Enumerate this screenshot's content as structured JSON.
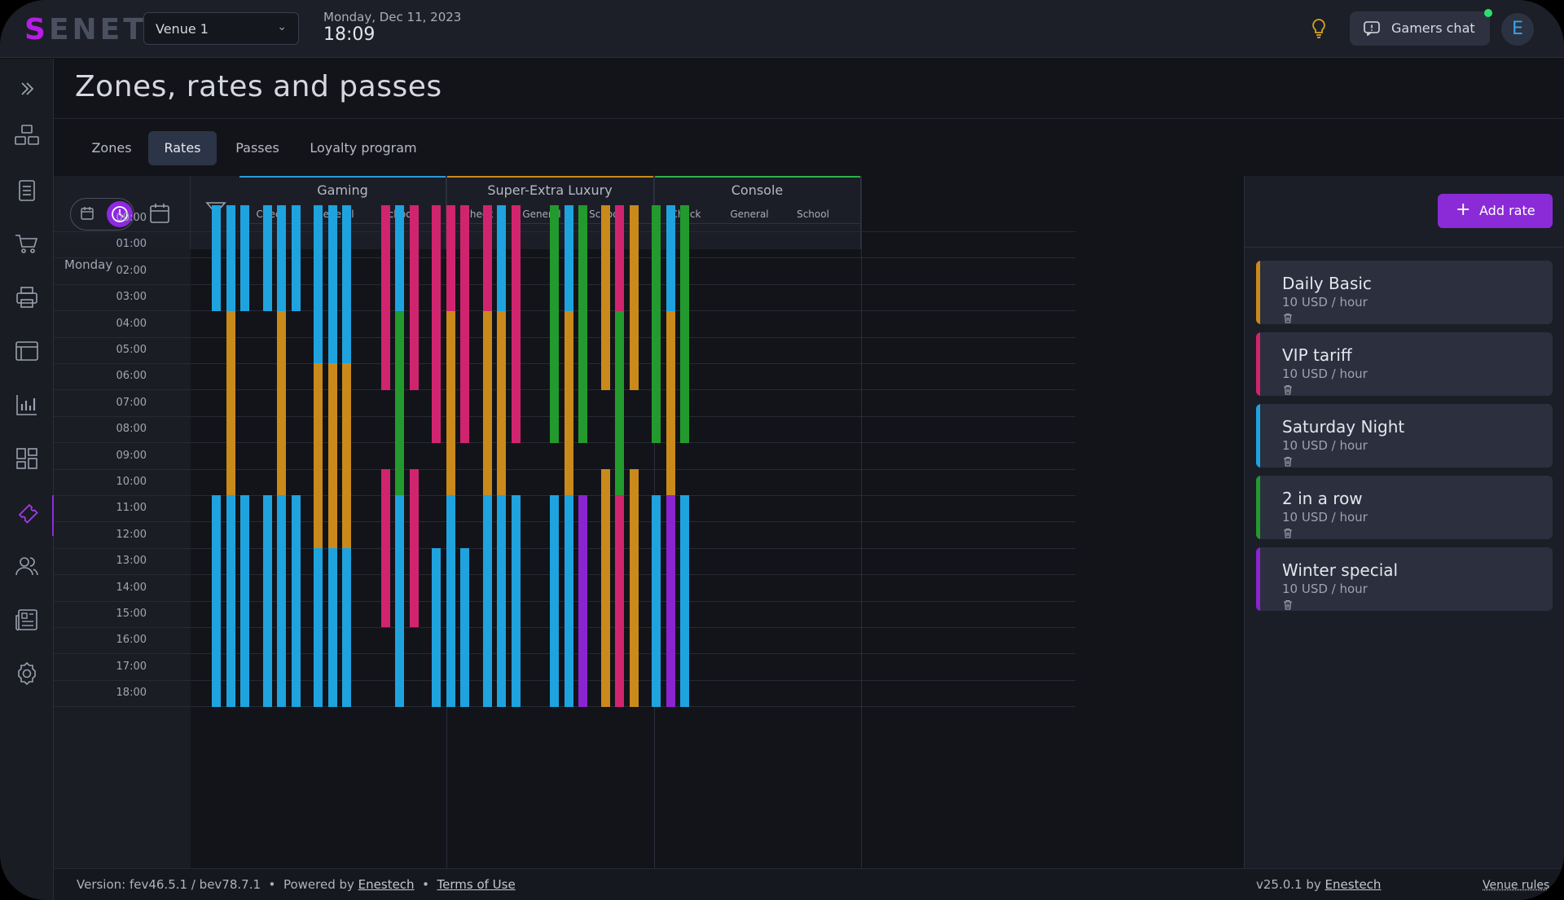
{
  "app": {
    "logo_s": "S",
    "logo_rest": "ENET",
    "venue": "Venue 1",
    "date": "Monday, Dec 11, 2023",
    "time": "18:09",
    "chat_label": "Gamers chat",
    "avatar_letter": "E",
    "accent_color": "#8b2bd8"
  },
  "page": {
    "title": "Zones, rates and passes",
    "tabs": [
      {
        "label": "Zones"
      },
      {
        "label": "Rates",
        "active": true
      },
      {
        "label": "Passes"
      },
      {
        "label": "Loyalty program"
      }
    ]
  },
  "schedule": {
    "view_mode": "time",
    "day": "Monday",
    "hours": [
      "00:00",
      "01:00",
      "02:00",
      "03:00",
      "04:00",
      "05:00",
      "06:00",
      "07:00",
      "08:00",
      "09:00",
      "10:00",
      "11:00",
      "12:00",
      "13:00",
      "14:00",
      "15:00",
      "16:00",
      "17:00",
      "18:00"
    ],
    "rate_categories": [
      "Check",
      "General",
      "School"
    ],
    "device_icons": [
      "monitor-icon",
      "gamepad-icon",
      "vr-icon"
    ],
    "zones": [
      {
        "name": "Gaming",
        "color": "#2a9bd8"
      },
      {
        "name": "Super-Extra Luxury",
        "color": "#c98a1b"
      },
      {
        "name": "Console",
        "color": "#2bb24a"
      }
    ],
    "rate_colors": {
      "Daily Basic": "#c98a1b",
      "VIP tariff": "#d1246f",
      "Saturday Night": "#1ea3df",
      "2 in a row": "#239a2d",
      "Winter special": "#8a24d1"
    },
    "columns": [
      [
        [
          "Saturday Night",
          0,
          4
        ],
        [
          "Saturday Night",
          11,
          19
        ]
      ],
      [
        [
          "Saturday Night",
          0,
          4
        ],
        [
          "Daily Basic",
          4,
          11
        ],
        [
          "Saturday Night",
          11,
          19
        ]
      ],
      [
        [
          "Saturday Night",
          0,
          4
        ],
        [
          "Saturday Night",
          11,
          19
        ]
      ],
      [
        [
          "Saturday Night",
          0,
          4
        ],
        [
          "Saturday Night",
          11,
          19
        ]
      ],
      [
        [
          "Saturday Night",
          0,
          4
        ],
        [
          "Daily Basic",
          4,
          11
        ],
        [
          "Saturday Night",
          11,
          19
        ]
      ],
      [
        [
          "Saturday Night",
          0,
          4
        ],
        [
          "Saturday Night",
          11,
          19
        ]
      ],
      [
        [
          "Saturday Night",
          0,
          6
        ],
        [
          "Daily Basic",
          6,
          13
        ],
        [
          "Saturday Night",
          13,
          19
        ]
      ],
      [
        [
          "Saturday Night",
          0,
          6
        ],
        [
          "Daily Basic",
          6,
          13
        ],
        [
          "Saturday Night",
          13,
          19
        ]
      ],
      [
        [
          "Saturday Night",
          0,
          6
        ],
        [
          "Daily Basic",
          6,
          13
        ],
        [
          "Saturday Night",
          13,
          19
        ]
      ],
      [
        [
          "VIP tariff",
          0,
          7
        ],
        [
          "VIP tariff",
          10,
          16
        ]
      ],
      [
        [
          "Saturday Night",
          0,
          4
        ],
        [
          "2 in a row",
          4,
          11
        ],
        [
          "Saturday Night",
          11,
          19
        ]
      ],
      [
        [
          "VIP tariff",
          0,
          7
        ],
        [
          "VIP tariff",
          10,
          16
        ]
      ],
      [
        [
          "VIP tariff",
          0,
          9
        ],
        [
          "Saturday Night",
          13,
          19
        ]
      ],
      [
        [
          "VIP tariff",
          0,
          4
        ],
        [
          "Daily Basic",
          4,
          11
        ],
        [
          "Saturday Night",
          11,
          19
        ]
      ],
      [
        [
          "VIP tariff",
          0,
          9
        ],
        [
          "Saturday Night",
          13,
          19
        ]
      ],
      [
        [
          "VIP tariff",
          0,
          4
        ],
        [
          "Daily Basic",
          4,
          11
        ],
        [
          "Saturday Night",
          11,
          19
        ]
      ],
      [
        [
          "Saturday Night",
          0,
          4
        ],
        [
          "Daily Basic",
          4,
          11
        ],
        [
          "Saturday Night",
          11,
          19
        ]
      ],
      [
        [
          "VIP tariff",
          0,
          9
        ],
        [
          "Saturday Night",
          11,
          19
        ]
      ],
      [
        [
          "2 in a row",
          0,
          9
        ],
        [
          "Saturday Night",
          11,
          19
        ]
      ],
      [
        [
          "Saturday Night",
          0,
          4
        ],
        [
          "Daily Basic",
          4,
          11
        ],
        [
          "Saturday Night",
          11,
          19
        ]
      ],
      [
        [
          "2 in a row",
          0,
          9
        ],
        [
          "Winter special",
          11,
          19
        ]
      ],
      [
        [
          "Daily Basic",
          0,
          7
        ],
        [
          "Daily Basic",
          10,
          19
        ]
      ],
      [
        [
          "VIP tariff",
          0,
          4
        ],
        [
          "2 in a row",
          4,
          11
        ],
        [
          "VIP tariff",
          11,
          19
        ]
      ],
      [
        [
          "Daily Basic",
          0,
          7
        ],
        [
          "Daily Basic",
          10,
          19
        ]
      ],
      [
        [
          "2 in a row",
          0,
          9
        ],
        [
          "Saturday Night",
          11,
          19
        ]
      ],
      [
        [
          "Saturday Night",
          0,
          4
        ],
        [
          "Daily Basic",
          4,
          11
        ],
        [
          "Winter special",
          11,
          19
        ]
      ],
      [
        [
          "2 in a row",
          0,
          9
        ],
        [
          "Saturday Night",
          11,
          19
        ]
      ]
    ]
  },
  "rates_panel": {
    "add_label": "Add rate",
    "rates": [
      {
        "name": "Daily Basic",
        "price": "10 USD / hour",
        "color": "#c98a1b"
      },
      {
        "name": "VIP tariff",
        "price": "10 USD / hour",
        "color": "#d1246f"
      },
      {
        "name": "Saturday Night",
        "price": "10 USD / hour",
        "color": "#1ea3df"
      },
      {
        "name": "2 in a row",
        "price": "10 USD / hour",
        "color": "#239a2d"
      },
      {
        "name": "Winter special",
        "price": "10 USD / hour",
        "color": "#8a24d1"
      }
    ]
  },
  "footer": {
    "version": "Version: fev46.5.1 / bev78.7.1",
    "powered_by": "Powered by",
    "company": "Enestech",
    "terms": "Terms of Use",
    "right_version": "v25.0.1 by",
    "right_company": "Enestech",
    "venue_rules": "Venue rules"
  }
}
